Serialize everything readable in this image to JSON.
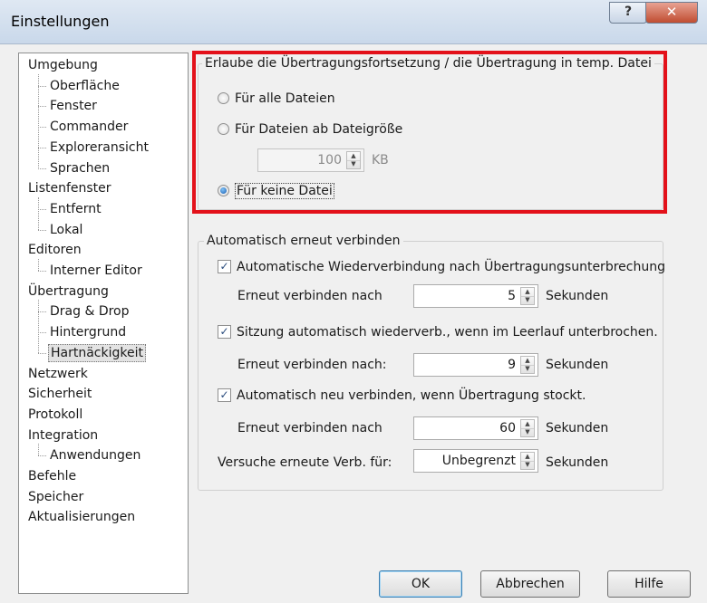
{
  "window": {
    "title": "Einstellungen",
    "help_glyph": "?",
    "close_glyph": "✕"
  },
  "tree": [
    {
      "label": "Umgebung",
      "level": 0
    },
    {
      "label": "Oberfläche",
      "level": 1
    },
    {
      "label": "Fenster",
      "level": 1
    },
    {
      "label": "Commander",
      "level": 1
    },
    {
      "label": "Exploreransicht",
      "level": 1
    },
    {
      "label": "Sprachen",
      "level": 1
    },
    {
      "label": "Listenfenster",
      "level": 0
    },
    {
      "label": "Entfernt",
      "level": 1
    },
    {
      "label": "Lokal",
      "level": 1
    },
    {
      "label": "Editoren",
      "level": 0
    },
    {
      "label": "Interner Editor",
      "level": 1
    },
    {
      "label": "Übertragung",
      "level": 0
    },
    {
      "label": "Drag & Drop",
      "level": 1
    },
    {
      "label": "Hintergrund",
      "level": 1
    },
    {
      "label": "Hartnäckigkeit",
      "level": 1,
      "selected": true
    },
    {
      "label": "Netzwerk",
      "level": 0
    },
    {
      "label": "Sicherheit",
      "level": 0
    },
    {
      "label": "Protokoll",
      "level": 0
    },
    {
      "label": "Integration",
      "level": 0
    },
    {
      "label": "Anwendungen",
      "level": 1
    },
    {
      "label": "Befehle",
      "level": 0
    },
    {
      "label": "Speicher",
      "level": 0
    },
    {
      "label": "Aktualisierungen",
      "level": 0
    }
  ],
  "resume_group": {
    "legend": "Erlaube die Übertragungsfortsetzung / die Übertragung in temp. Datei",
    "options": [
      {
        "label": "Für alle Dateien",
        "checked": false
      },
      {
        "label": "Für Dateien ab Dateigröße",
        "checked": false
      },
      {
        "label": "Für keine Datei",
        "checked": true
      }
    ],
    "size_value": "100",
    "size_unit": "KB"
  },
  "reconnect_group": {
    "legend": "Automatisch erneut verbinden",
    "check1": {
      "label": "Automatische Wiederverbindung nach Übertragungsunterbrechung",
      "checked": true
    },
    "row1": {
      "label": "Erneut verbinden nach",
      "value": "5",
      "unit": "Sekunden"
    },
    "check2": {
      "label": "Sitzung automatisch wiederverb., wenn im Leerlauf unterbrochen.",
      "checked": true
    },
    "row2": {
      "label": "Erneut verbinden nach:",
      "value": "9",
      "unit": "Sekunden"
    },
    "check3": {
      "label": "Automatisch neu verbinden, wenn Übertragung stockt.",
      "checked": true
    },
    "row3": {
      "label": "Erneut verbinden nach",
      "value": "60",
      "unit": "Sekunden"
    },
    "row4": {
      "label": "Versuche erneute Verb. für:",
      "value": "Unbegrenzt",
      "unit": "Sekunden"
    }
  },
  "buttons": {
    "ok": "OK",
    "cancel": "Abbrechen",
    "help": "Hilfe"
  },
  "colors": {
    "highlight": "#e3111a",
    "accent": "#1a5fb4"
  }
}
